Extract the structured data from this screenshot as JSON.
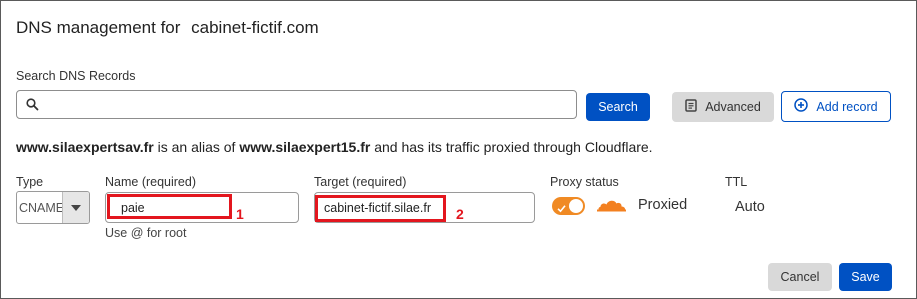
{
  "header": {
    "title": "DNS management for",
    "domain": "cabinet-fictif.com"
  },
  "search": {
    "label": "Search DNS Records",
    "value": "",
    "placeholder": "",
    "icon": "search-icon",
    "button_label": "Search"
  },
  "toolbar": {
    "advanced_label": "Advanced",
    "advanced_icon": "document-icon",
    "add_record_label": "Add record",
    "add_record_icon": "plus-circle-icon"
  },
  "alias_notice": {
    "alias_domain": "www.silaexpertsav.fr",
    "text_1": "is an alias of",
    "target_domain": "www.silaexpert15.fr",
    "text_2": "and has its traffic proxied through Cloudflare."
  },
  "record_form": {
    "type": {
      "label": "Type",
      "value": "CNAME"
    },
    "name": {
      "label": "Name (required)",
      "value": "paie",
      "hint": "Use @ for root",
      "annotation": "1"
    },
    "target": {
      "label": "Target (required)",
      "value": "cabinet-fictif.silae.fr",
      "annotation": "2"
    },
    "proxy_status": {
      "label": "Proxy status",
      "enabled": true,
      "value": "Proxied",
      "icon": "cloud-icon"
    },
    "ttl": {
      "label": "TTL",
      "value": "Auto"
    }
  },
  "footer": {
    "cancel_label": "Cancel",
    "save_label": "Save"
  },
  "colors": {
    "primary": "#0051c3",
    "highlight": "#e3161e",
    "proxy_orange": "#f08a24"
  }
}
